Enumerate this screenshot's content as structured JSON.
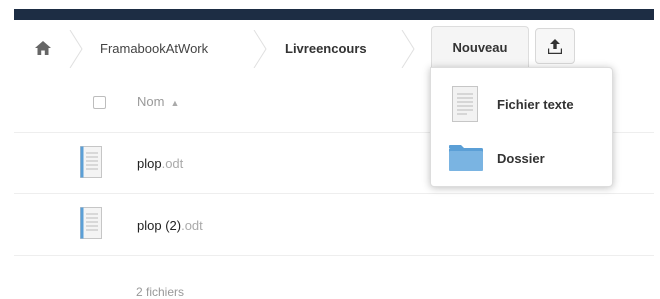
{
  "breadcrumb": {
    "home_icon": "home-icon",
    "items": [
      "FramabookAtWork",
      "Livreencours"
    ]
  },
  "toolbar": {
    "new_label": "Nouveau",
    "upload_icon": "upload-icon"
  },
  "new_menu": {
    "items": [
      {
        "label": "Fichier texte",
        "icon": "text-file-icon"
      },
      {
        "label": "Dossier",
        "icon": "folder-icon"
      }
    ]
  },
  "file_list": {
    "header": {
      "name_label": "Nom",
      "sort_icon": "▲"
    },
    "files": [
      {
        "name": "plop",
        "ext": ".odt"
      },
      {
        "name": "plop (2)",
        "ext": ".odt"
      }
    ],
    "summary": "2 fichiers"
  },
  "colors": {
    "topbar": "#1d2d44",
    "folder": "#5b9fd6"
  }
}
